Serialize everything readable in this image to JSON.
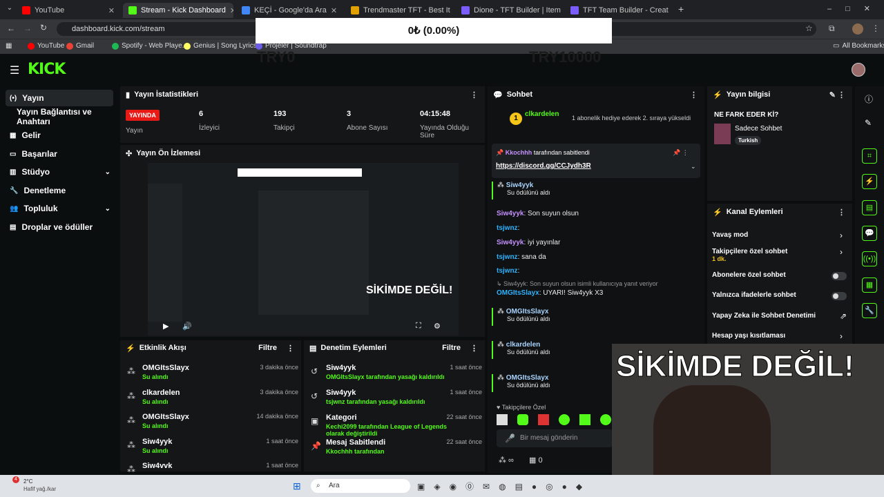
{
  "browser": {
    "tabs": [
      {
        "title": "YouTube",
        "color": "#ff0000",
        "active": false
      },
      {
        "title": "Stream - Kick Dashboard",
        "color": "#53fc18",
        "active": true
      },
      {
        "title": "KEÇİ - Google'da Ara",
        "color": "#4285f4",
        "active": false
      },
      {
        "title": "Trendmaster TFT - Best Items a...",
        "color": "#e0a000",
        "active": false
      },
      {
        "title": "Dione - TFT Builder | Items /",
        "color": "#7a5cff",
        "active": false
      },
      {
        "title": "TFT Team Builder - Create & Sh",
        "color": "#7a5cff",
        "active": false
      }
    ],
    "url": "dashboard.kick.com/stream",
    "bookmarks": [
      "YouTube",
      "Gmail",
      "Spotify - Web Playe...",
      "Genius | Song Lyrics...",
      "Projeler | Soundtrap"
    ],
    "all_bookmarks": "All Bookmarks"
  },
  "overlay": {
    "value": "0₺ (0.00%)",
    "ghost_left": "TRY0",
    "ghost_right": "TRY10000"
  },
  "kick": {
    "logo": "KICK",
    "sidebar": [
      {
        "label": "Yayın",
        "icon": "(•)",
        "active": true
      },
      {
        "label": "Yayın Bağlantısı ve Anahtarı",
        "icon": "",
        "active": false
      },
      {
        "label": "Gelir",
        "icon": "▦",
        "active": false
      },
      {
        "label": "Başarılar",
        "icon": "▭",
        "active": false
      },
      {
        "label": "Stüdyo",
        "icon": "▥",
        "active": false,
        "chevron": "⌄"
      },
      {
        "label": "Denetleme",
        "icon": "🔧",
        "active": false
      },
      {
        "label": "Topluluk",
        "icon": "👥",
        "active": false,
        "chevron": "⌄"
      },
      {
        "label": "Droplar ve ödüller",
        "icon": "▤",
        "active": false
      }
    ],
    "stats": {
      "title": "Yayın İstatistikleri",
      "live_badge": "YAYINDA",
      "items": [
        {
          "value": "",
          "label": "Yayın"
        },
        {
          "value": "6",
          "label": "İzleyici"
        },
        {
          "value": "193",
          "label": "Takipçi"
        },
        {
          "value": "3",
          "label": "Abone Sayısı"
        },
        {
          "value": "04:15:48",
          "label": "Yayında Olduğu Süre"
        }
      ]
    },
    "preview": {
      "title": "Yayın Ön İzlemesi",
      "caption": "SİKİMDE DEĞİL!"
    },
    "activity": {
      "title": "Etkinlik Akışı",
      "filter": "Filtre",
      "items": [
        {
          "name": "OMGItsSlayx",
          "sub": "Su alındı",
          "time": "3 dakika önce"
        },
        {
          "name": "clkardelen",
          "sub": "Su alındı",
          "time": "3 dakika önce"
        },
        {
          "name": "OMGItsSlayx",
          "sub": "Su alındı",
          "time": "14 dakika önce"
        },
        {
          "name": "Siw4yyk",
          "sub": "Su alındı",
          "time": "1 saat önce"
        },
        {
          "name": "Siw4vvk",
          "sub": "",
          "time": "1 saat önce"
        }
      ]
    },
    "moderation": {
      "title": "Denetim Eylemleri",
      "filter": "Filtre",
      "items": [
        {
          "name": "Siw4yyk",
          "sub_user": "OMGItsSlayx",
          "sub_text": " tarafından yasağı kaldırıldı",
          "time": "1 saat önce",
          "icon": "↺"
        },
        {
          "name": "Siw4yyk",
          "sub_user": "tsjwnz",
          "sub_text": " tarafından yasağı kaldırıldı",
          "time": "1 saat önce",
          "icon": "↺"
        },
        {
          "name": "Kategori",
          "sub_user": "Kechi2099",
          "sub_text": " tarafından League of Legends olarak değiştirildi",
          "time": "22 saat önce",
          "icon": "▣"
        },
        {
          "name": "Mesaj Sabitlendi",
          "sub_user": "Kkochhh",
          "sub_text": " tarafından",
          "time": "22 saat önce",
          "icon": "📌"
        }
      ]
    },
    "chat": {
      "title": "Sohbet",
      "top_gifter": "clkardelen",
      "top_gifter_count": "1",
      "gift_info": "1 abonelik hediye ederek 2. sıraya yükseldi",
      "pinned_by": "Kkochhh",
      "pinned_text": " tarafından sabitlendi",
      "pinned_link": "https://discord.gg/CCJydh3R",
      "lines": [
        {
          "user": "Siw4yyk",
          "text": "Su ödülünü aldı",
          "kind": "reward"
        },
        {
          "user": "Siw4yyk",
          "text": ": Son suyun olsun",
          "kind": "msg",
          "color": "#c792ff"
        },
        {
          "user": "tsjwnz",
          "text": ":",
          "kind": "msg",
          "color": "#2db3ff"
        },
        {
          "user": "Siw4yyk",
          "text": ": iyi yayınlar",
          "kind": "msg",
          "color": "#c792ff"
        },
        {
          "user": "tsjwnz",
          "text": ": sana da",
          "kind": "msg",
          "color": "#2db3ff"
        },
        {
          "user": "tsjwnz",
          "text": ":",
          "kind": "msg",
          "color": "#2db3ff"
        },
        {
          "user": "",
          "text": "↳ Siw4yyk: Son suyun olsun isimli kullanıcıya yanıt veriyor",
          "kind": "reply"
        },
        {
          "user": "OMGItsSlayx",
          "text": ": UYARI! Siw4yyk X3",
          "kind": "msg",
          "color": "#2db3ff"
        },
        {
          "user": "OMGItsSlayx",
          "text": "Su ödülünü aldı",
          "kind": "reward"
        },
        {
          "user": "clkardelen",
          "text": "Su ödülünü aldı",
          "kind": "reward"
        },
        {
          "user": "OMGItsSlayx",
          "text": "Su ödülünü aldı",
          "kind": "reward"
        }
      ],
      "followers_only": "Takipçilere Özel",
      "input_placeholder": "Bir mesaj gönderin",
      "bottom_count": "0"
    },
    "info": {
      "title": "Yayın bilgisi",
      "stream_title": "NE FARK EDER Kİ?",
      "category": "Sadece Sohbet",
      "tag": "Turkish"
    },
    "channel_actions": {
      "title": "Kanal Eylemleri",
      "items": [
        {
          "label": "Yavaş mod",
          "control": "chevron"
        },
        {
          "label": "Takipçilere özel sohbet",
          "sub": "1 dk.",
          "control": "chevron"
        },
        {
          "label": "Abonelere özel sohbet",
          "control": "toggle"
        },
        {
          "label": "Yalnızca ifadelerle sohbet",
          "control": "toggle"
        },
        {
          "label": "Yapay Zeka ile Sohbet Denetimi",
          "control": "external"
        },
        {
          "label": "Hesap yaşı kısıtlaması",
          "control": "chevron"
        }
      ]
    },
    "webcam_caption": "SİKİMDE DEĞİL!"
  },
  "taskbar": {
    "weather_temp": "2°C",
    "weather_desc": "Hafif yağ./kar",
    "search": "Ara",
    "weather_badge": "4"
  }
}
